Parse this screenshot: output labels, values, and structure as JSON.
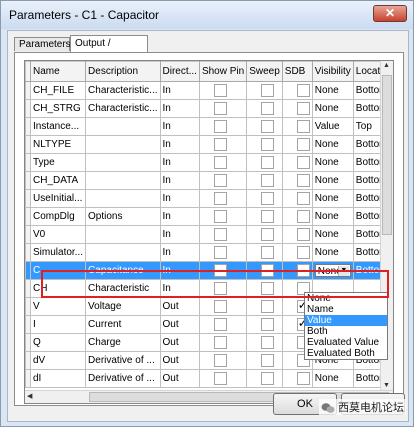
{
  "window": {
    "title": "Parameters - C1 - Capacitor",
    "close_glyph": "✕"
  },
  "tabs": [
    {
      "label": "Parameters"
    },
    {
      "label": "Output / Display"
    }
  ],
  "columns": [
    "Name",
    "Description",
    "Direct...",
    "Show Pin",
    "Sweep",
    "SDB",
    "Visibility",
    "Location"
  ],
  "rows": [
    {
      "name": "CH_FILE",
      "description": "Characteristic...",
      "direction": "In",
      "visibility": "None",
      "location": "Bottom"
    },
    {
      "name": "CH_STRG",
      "description": "Characteristic...",
      "direction": "In",
      "visibility": "None",
      "location": "Bottom"
    },
    {
      "name": "Instance...",
      "description": "",
      "direction": "In",
      "visibility": "Value",
      "location": "Top"
    },
    {
      "name": "NLTYPE",
      "description": "",
      "direction": "In",
      "visibility": "None",
      "location": "Bottom"
    },
    {
      "name": "Type",
      "description": "",
      "direction": "In",
      "visibility": "None",
      "location": "Bottom"
    },
    {
      "name": "CH_DATA",
      "description": "",
      "direction": "In",
      "visibility": "None",
      "location": "Bottom"
    },
    {
      "name": "UseInitial...",
      "description": "",
      "direction": "In",
      "visibility": "None",
      "location": "Bottom"
    },
    {
      "name": "CompDlg",
      "description": "Options",
      "direction": "In",
      "visibility": "None",
      "location": "Bottom"
    },
    {
      "name": "V0",
      "description": "",
      "direction": "In",
      "visibility": "None",
      "location": "Bottom"
    },
    {
      "name": "Simulator...",
      "description": "",
      "direction": "In",
      "visibility": "None",
      "location": "Bottom"
    },
    {
      "name": "C",
      "description": "Capacitance",
      "direction": "In",
      "visibility": "None",
      "location": "Bottom"
    },
    {
      "name": "CH",
      "description": "Characteristic",
      "direction": "In",
      "visibility": "",
      "location": ""
    },
    {
      "name": "V",
      "description": "Voltage",
      "direction": "Out",
      "visibility": "",
      "location": ""
    },
    {
      "name": "I",
      "description": "Current",
      "direction": "Out",
      "visibility": "",
      "location": ""
    },
    {
      "name": "Q",
      "description": "Charge",
      "direction": "Out",
      "visibility": "",
      "location": ""
    },
    {
      "name": "dV",
      "description": "Derivative of ...",
      "direction": "Out",
      "visibility": "None",
      "location": "Bottom"
    },
    {
      "name": "dI",
      "description": "Derivative of ...",
      "direction": "Out",
      "visibility": "None",
      "location": "Bottom"
    }
  ],
  "dropdown": {
    "selected": "None",
    "options": [
      "None",
      "Name",
      "Value",
      "Both",
      "Evaluated Value",
      "Evaluated Both"
    ],
    "highlighted": "Value"
  },
  "buttons": {
    "ok": "OK"
  },
  "watermark": {
    "text": "西莫电机论坛"
  },
  "colors": {
    "selection": "#3399ff",
    "highlight_box": "#e02020"
  }
}
